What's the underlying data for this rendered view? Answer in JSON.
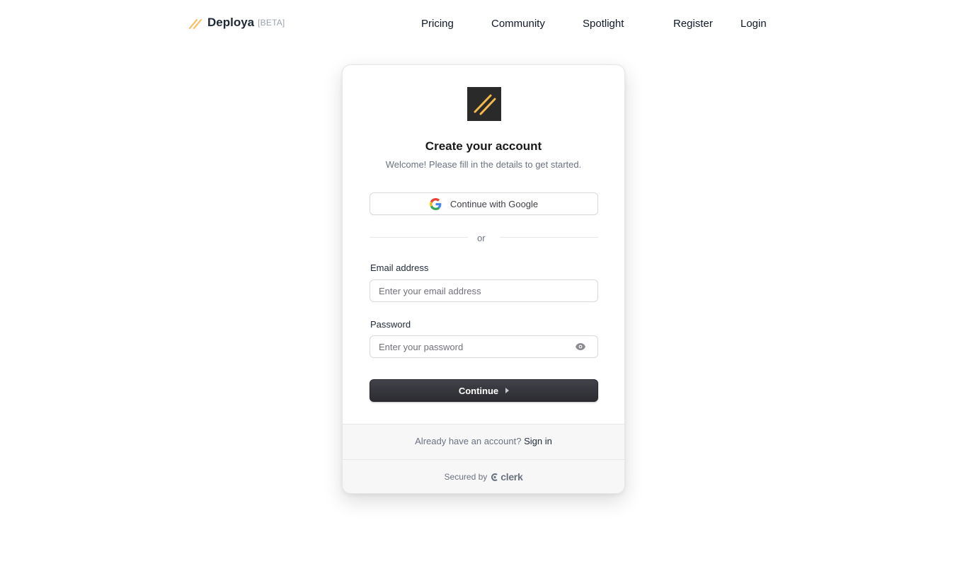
{
  "header": {
    "brand_name": "Deploya",
    "brand_badge": "[BETA]",
    "brand_icon": "double-slash-logo-icon",
    "nav": {
      "pricing": "Pricing",
      "community": "Community",
      "spotlight": "Spotlight",
      "register": "Register",
      "login": "Login"
    }
  },
  "card": {
    "logo_icon": "double-slash-logo-icon",
    "title": "Create your account",
    "subtitle": "Welcome! Please fill in the details to get started.",
    "google_button": {
      "label": "Continue with Google",
      "icon": "google-icon"
    },
    "divider_text": "or",
    "email": {
      "label": "Email address",
      "placeholder": "Enter your email address",
      "value": ""
    },
    "password": {
      "label": "Password",
      "placeholder": "Enter your password",
      "value": "",
      "toggle_icon": "eye-icon"
    },
    "continue_button": {
      "label": "Continue",
      "icon": "caret-right-icon"
    },
    "footer": {
      "prompt": "Already have an account?",
      "signin_link": "Sign in",
      "secured_by": "Secured by",
      "provider": "clerk"
    }
  },
  "colors": {
    "accent": "#f5b84a",
    "primary_button": "#2f2f35",
    "logo_bg": "#2a2a2a",
    "muted_text": "#6b7280"
  }
}
